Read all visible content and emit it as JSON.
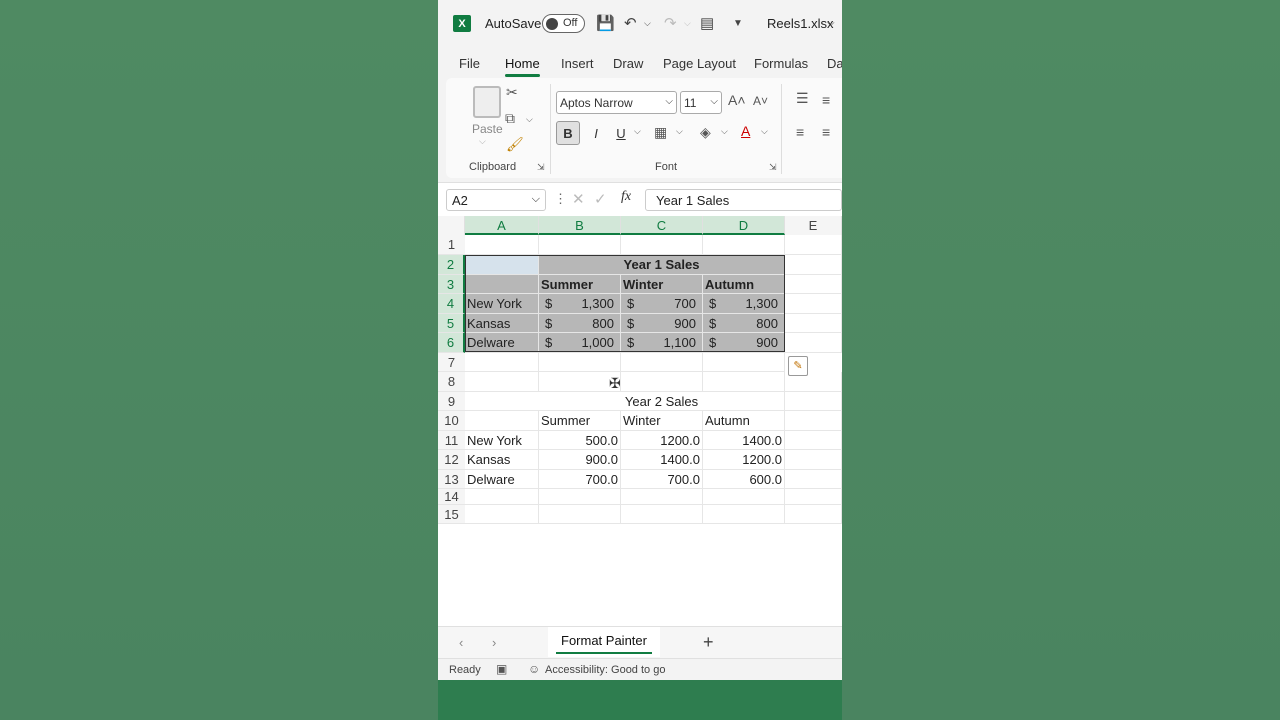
{
  "titlebar": {
    "logo": "X",
    "autosave_label": "AutoSave",
    "autosave_state": "Off",
    "filename": "Reels1.xlsx"
  },
  "tabs": [
    "File",
    "Home",
    "Insert",
    "Draw",
    "Page Layout",
    "Formulas",
    "Da"
  ],
  "ribbon": {
    "paste_label": "Paste",
    "clipboard_label": "Clipboard",
    "font_name": "Aptos Narrow",
    "font_size": "11",
    "font_label": "Font",
    "bold": "B",
    "italic": "I",
    "underline": "U"
  },
  "formula_bar": {
    "namebox": "A2",
    "fx": "fx",
    "content": "Year 1 Sales"
  },
  "columns": [
    "A",
    "B",
    "C",
    "D",
    "E"
  ],
  "rows": [
    "1",
    "2",
    "3",
    "4",
    "5",
    "6",
    "7",
    "8",
    "9",
    "10",
    "11",
    "12",
    "13",
    "14",
    "15"
  ],
  "table1": {
    "title": "Year 1 Sales",
    "headers": [
      "Summer",
      "Winter",
      "Autumn"
    ],
    "currency": "$",
    "data": [
      {
        "name": "New York",
        "values": [
          "1,300",
          "700",
          "1,300"
        ]
      },
      {
        "name": "Kansas",
        "values": [
          "800",
          "900",
          "800"
        ]
      },
      {
        "name": "Delware",
        "values": [
          "1,000",
          "1,100",
          "900"
        ]
      }
    ]
  },
  "table2": {
    "title": "Year 2 Sales",
    "headers": [
      "Summer",
      "Winter",
      "Autumn"
    ],
    "data": [
      {
        "name": "New York",
        "values": [
          "500.0",
          "1200.0",
          "1400.0"
        ]
      },
      {
        "name": "Kansas",
        "values": [
          "900.0",
          "1400.0",
          "1200.0"
        ]
      },
      {
        "name": "Delware",
        "values": [
          "700.0",
          "700.0",
          "600.0"
        ]
      }
    ]
  },
  "sheet": {
    "active_tab": "Format Painter",
    "add": "+"
  },
  "status": {
    "ready": "Ready",
    "accessibility": "Accessibility: Good to go"
  },
  "colors": {
    "accent": "#107c41",
    "shade": "#b7b7b7"
  }
}
